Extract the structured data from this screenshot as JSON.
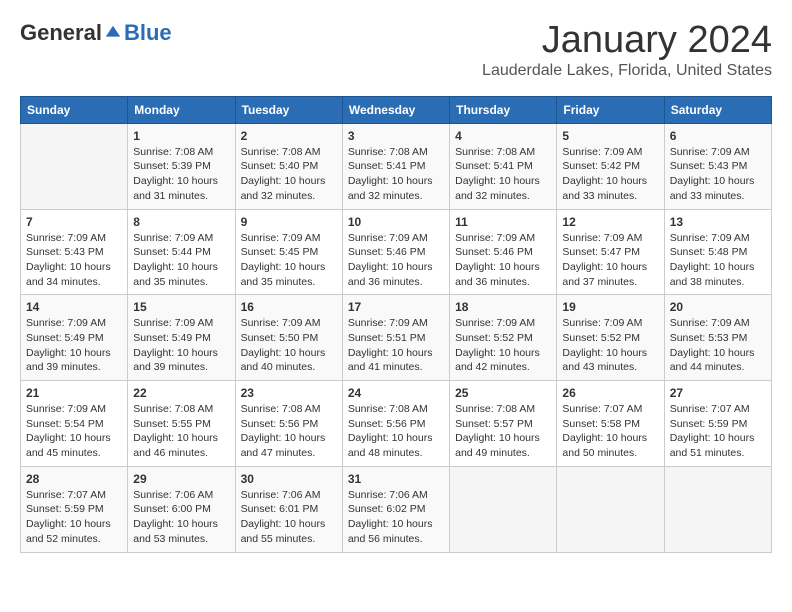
{
  "header": {
    "logo_general": "General",
    "logo_blue": "Blue",
    "month_title": "January 2024",
    "location": "Lauderdale Lakes, Florida, United States"
  },
  "days_of_week": [
    "Sunday",
    "Monday",
    "Tuesday",
    "Wednesday",
    "Thursday",
    "Friday",
    "Saturday"
  ],
  "weeks": [
    [
      {
        "day": "",
        "sunrise": "",
        "sunset": "",
        "daylight": ""
      },
      {
        "day": "1",
        "sunrise": "Sunrise: 7:08 AM",
        "sunset": "Sunset: 5:39 PM",
        "daylight": "Daylight: 10 hours and 31 minutes."
      },
      {
        "day": "2",
        "sunrise": "Sunrise: 7:08 AM",
        "sunset": "Sunset: 5:40 PM",
        "daylight": "Daylight: 10 hours and 32 minutes."
      },
      {
        "day": "3",
        "sunrise": "Sunrise: 7:08 AM",
        "sunset": "Sunset: 5:41 PM",
        "daylight": "Daylight: 10 hours and 32 minutes."
      },
      {
        "day": "4",
        "sunrise": "Sunrise: 7:08 AM",
        "sunset": "Sunset: 5:41 PM",
        "daylight": "Daylight: 10 hours and 32 minutes."
      },
      {
        "day": "5",
        "sunrise": "Sunrise: 7:09 AM",
        "sunset": "Sunset: 5:42 PM",
        "daylight": "Daylight: 10 hours and 33 minutes."
      },
      {
        "day": "6",
        "sunrise": "Sunrise: 7:09 AM",
        "sunset": "Sunset: 5:43 PM",
        "daylight": "Daylight: 10 hours and 33 minutes."
      }
    ],
    [
      {
        "day": "7",
        "sunrise": "Sunrise: 7:09 AM",
        "sunset": "Sunset: 5:43 PM",
        "daylight": "Daylight: 10 hours and 34 minutes."
      },
      {
        "day": "8",
        "sunrise": "Sunrise: 7:09 AM",
        "sunset": "Sunset: 5:44 PM",
        "daylight": "Daylight: 10 hours and 35 minutes."
      },
      {
        "day": "9",
        "sunrise": "Sunrise: 7:09 AM",
        "sunset": "Sunset: 5:45 PM",
        "daylight": "Daylight: 10 hours and 35 minutes."
      },
      {
        "day": "10",
        "sunrise": "Sunrise: 7:09 AM",
        "sunset": "Sunset: 5:46 PM",
        "daylight": "Daylight: 10 hours and 36 minutes."
      },
      {
        "day": "11",
        "sunrise": "Sunrise: 7:09 AM",
        "sunset": "Sunset: 5:46 PM",
        "daylight": "Daylight: 10 hours and 36 minutes."
      },
      {
        "day": "12",
        "sunrise": "Sunrise: 7:09 AM",
        "sunset": "Sunset: 5:47 PM",
        "daylight": "Daylight: 10 hours and 37 minutes."
      },
      {
        "day": "13",
        "sunrise": "Sunrise: 7:09 AM",
        "sunset": "Sunset: 5:48 PM",
        "daylight": "Daylight: 10 hours and 38 minutes."
      }
    ],
    [
      {
        "day": "14",
        "sunrise": "Sunrise: 7:09 AM",
        "sunset": "Sunset: 5:49 PM",
        "daylight": "Daylight: 10 hours and 39 minutes."
      },
      {
        "day": "15",
        "sunrise": "Sunrise: 7:09 AM",
        "sunset": "Sunset: 5:49 PM",
        "daylight": "Daylight: 10 hours and 39 minutes."
      },
      {
        "day": "16",
        "sunrise": "Sunrise: 7:09 AM",
        "sunset": "Sunset: 5:50 PM",
        "daylight": "Daylight: 10 hours and 40 minutes."
      },
      {
        "day": "17",
        "sunrise": "Sunrise: 7:09 AM",
        "sunset": "Sunset: 5:51 PM",
        "daylight": "Daylight: 10 hours and 41 minutes."
      },
      {
        "day": "18",
        "sunrise": "Sunrise: 7:09 AM",
        "sunset": "Sunset: 5:52 PM",
        "daylight": "Daylight: 10 hours and 42 minutes."
      },
      {
        "day": "19",
        "sunrise": "Sunrise: 7:09 AM",
        "sunset": "Sunset: 5:52 PM",
        "daylight": "Daylight: 10 hours and 43 minutes."
      },
      {
        "day": "20",
        "sunrise": "Sunrise: 7:09 AM",
        "sunset": "Sunset: 5:53 PM",
        "daylight": "Daylight: 10 hours and 44 minutes."
      }
    ],
    [
      {
        "day": "21",
        "sunrise": "Sunrise: 7:09 AM",
        "sunset": "Sunset: 5:54 PM",
        "daylight": "Daylight: 10 hours and 45 minutes."
      },
      {
        "day": "22",
        "sunrise": "Sunrise: 7:08 AM",
        "sunset": "Sunset: 5:55 PM",
        "daylight": "Daylight: 10 hours and 46 minutes."
      },
      {
        "day": "23",
        "sunrise": "Sunrise: 7:08 AM",
        "sunset": "Sunset: 5:56 PM",
        "daylight": "Daylight: 10 hours and 47 minutes."
      },
      {
        "day": "24",
        "sunrise": "Sunrise: 7:08 AM",
        "sunset": "Sunset: 5:56 PM",
        "daylight": "Daylight: 10 hours and 48 minutes."
      },
      {
        "day": "25",
        "sunrise": "Sunrise: 7:08 AM",
        "sunset": "Sunset: 5:57 PM",
        "daylight": "Daylight: 10 hours and 49 minutes."
      },
      {
        "day": "26",
        "sunrise": "Sunrise: 7:07 AM",
        "sunset": "Sunset: 5:58 PM",
        "daylight": "Daylight: 10 hours and 50 minutes."
      },
      {
        "day": "27",
        "sunrise": "Sunrise: 7:07 AM",
        "sunset": "Sunset: 5:59 PM",
        "daylight": "Daylight: 10 hours and 51 minutes."
      }
    ],
    [
      {
        "day": "28",
        "sunrise": "Sunrise: 7:07 AM",
        "sunset": "Sunset: 5:59 PM",
        "daylight": "Daylight: 10 hours and 52 minutes."
      },
      {
        "day": "29",
        "sunrise": "Sunrise: 7:06 AM",
        "sunset": "Sunset: 6:00 PM",
        "daylight": "Daylight: 10 hours and 53 minutes."
      },
      {
        "day": "30",
        "sunrise": "Sunrise: 7:06 AM",
        "sunset": "Sunset: 6:01 PM",
        "daylight": "Daylight: 10 hours and 55 minutes."
      },
      {
        "day": "31",
        "sunrise": "Sunrise: 7:06 AM",
        "sunset": "Sunset: 6:02 PM",
        "daylight": "Daylight: 10 hours and 56 minutes."
      },
      {
        "day": "",
        "sunrise": "",
        "sunset": "",
        "daylight": ""
      },
      {
        "day": "",
        "sunrise": "",
        "sunset": "",
        "daylight": ""
      },
      {
        "day": "",
        "sunrise": "",
        "sunset": "",
        "daylight": ""
      }
    ]
  ]
}
